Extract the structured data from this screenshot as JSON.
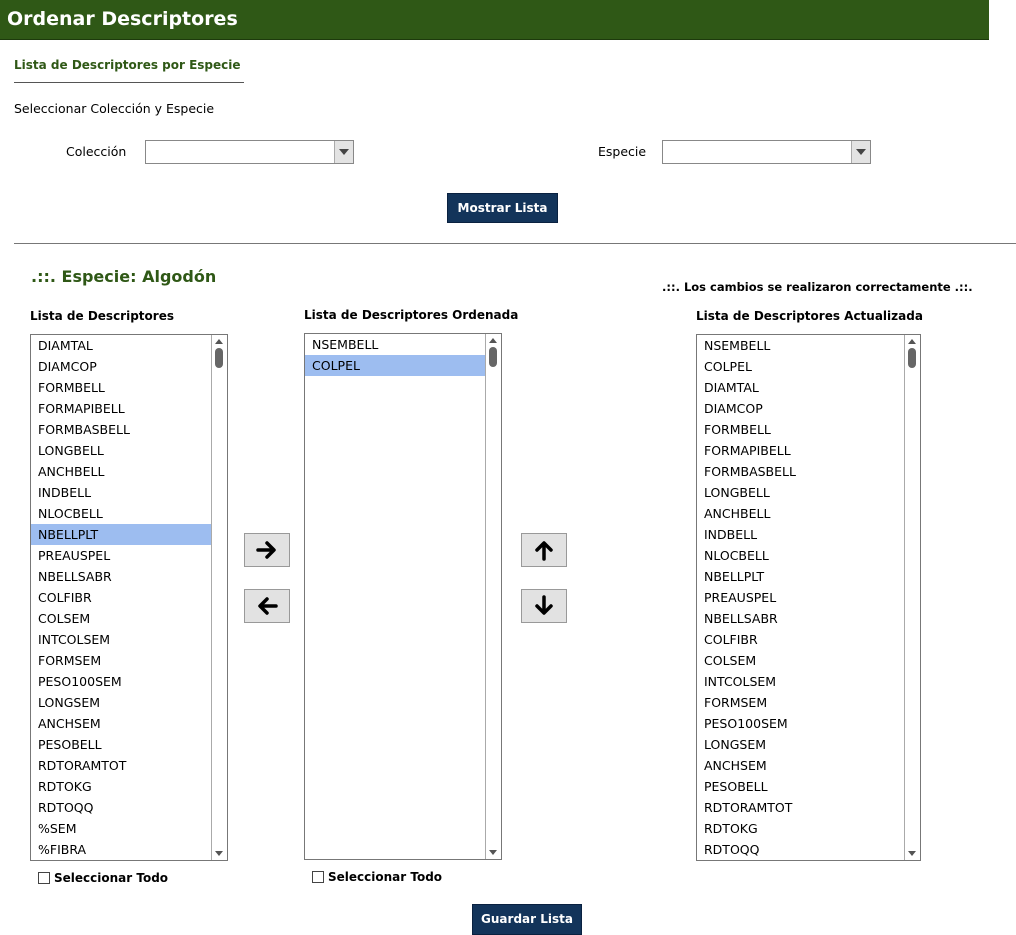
{
  "header": {
    "title": "Ordenar Descriptores"
  },
  "section": {
    "subtitle": "Lista de Descriptores por Especie",
    "instruction": "Seleccionar Colección y Especie"
  },
  "filters": {
    "coleccion_label": "Colección",
    "coleccion_value": "",
    "especie_label": "Especie",
    "especie_value": "",
    "show_button": "Mostrar Lista"
  },
  "species_heading": ".::. Especie: Algodón",
  "status_message": ".::. Los cambios se realizaron correctamente .::.",
  "lists": {
    "source": {
      "title": "Lista de Descriptores",
      "selected": "NBELLPLT",
      "items": [
        "DIAMTAL",
        "DIAMCOP",
        "FORMBELL",
        "FORMAPIBELL",
        "FORMBASBELL",
        "LONGBELL",
        "ANCHBELL",
        "INDBELL",
        "NLOCBELL",
        "NBELLPLT",
        "PREAUSPEL",
        "NBELLSABR",
        "COLFIBR",
        "COLSEM",
        "INTCOLSEM",
        "FORMSEM",
        "PESO100SEM",
        "LONGSEM",
        "ANCHSEM",
        "PESOBELL",
        "RDTORAMTOT",
        "RDTOKG",
        "RDTOQQ",
        "%SEM",
        "%FIBRA"
      ],
      "select_all": "Seleccionar Todo"
    },
    "ordered": {
      "title": "Lista de Descriptores Ordenada",
      "selected": "COLPEL",
      "items": [
        "NSEMBELL",
        "COLPEL"
      ],
      "select_all": "Seleccionar Todo"
    },
    "updated": {
      "title": "Lista de Descriptores Actualizada",
      "items": [
        "NSEMBELL",
        "COLPEL",
        "DIAMTAL",
        "DIAMCOP",
        "FORMBELL",
        "FORMAPIBELL",
        "FORMBASBELL",
        "LONGBELL",
        "ANCHBELL",
        "INDBELL",
        "NLOCBELL",
        "NBELLPLT",
        "PREAUSPEL",
        "NBELLSABR",
        "COLFIBR",
        "COLSEM",
        "INTCOLSEM",
        "FORMSEM",
        "PESO100SEM",
        "LONGSEM",
        "ANCHSEM",
        "PESOBELL",
        "RDTORAMTOT",
        "RDTOKG",
        "RDTOQQ"
      ]
    }
  },
  "actions": {
    "save_button": "Guardar Lista"
  },
  "icons": {
    "move_right": "arrow-right-icon",
    "move_left": "arrow-left-icon",
    "move_up": "arrow-up-icon",
    "move_down": "arrow-down-icon"
  },
  "colors": {
    "header_bg": "#2f5816",
    "button_bg": "#13345a",
    "selection": "#9dbdf0"
  }
}
